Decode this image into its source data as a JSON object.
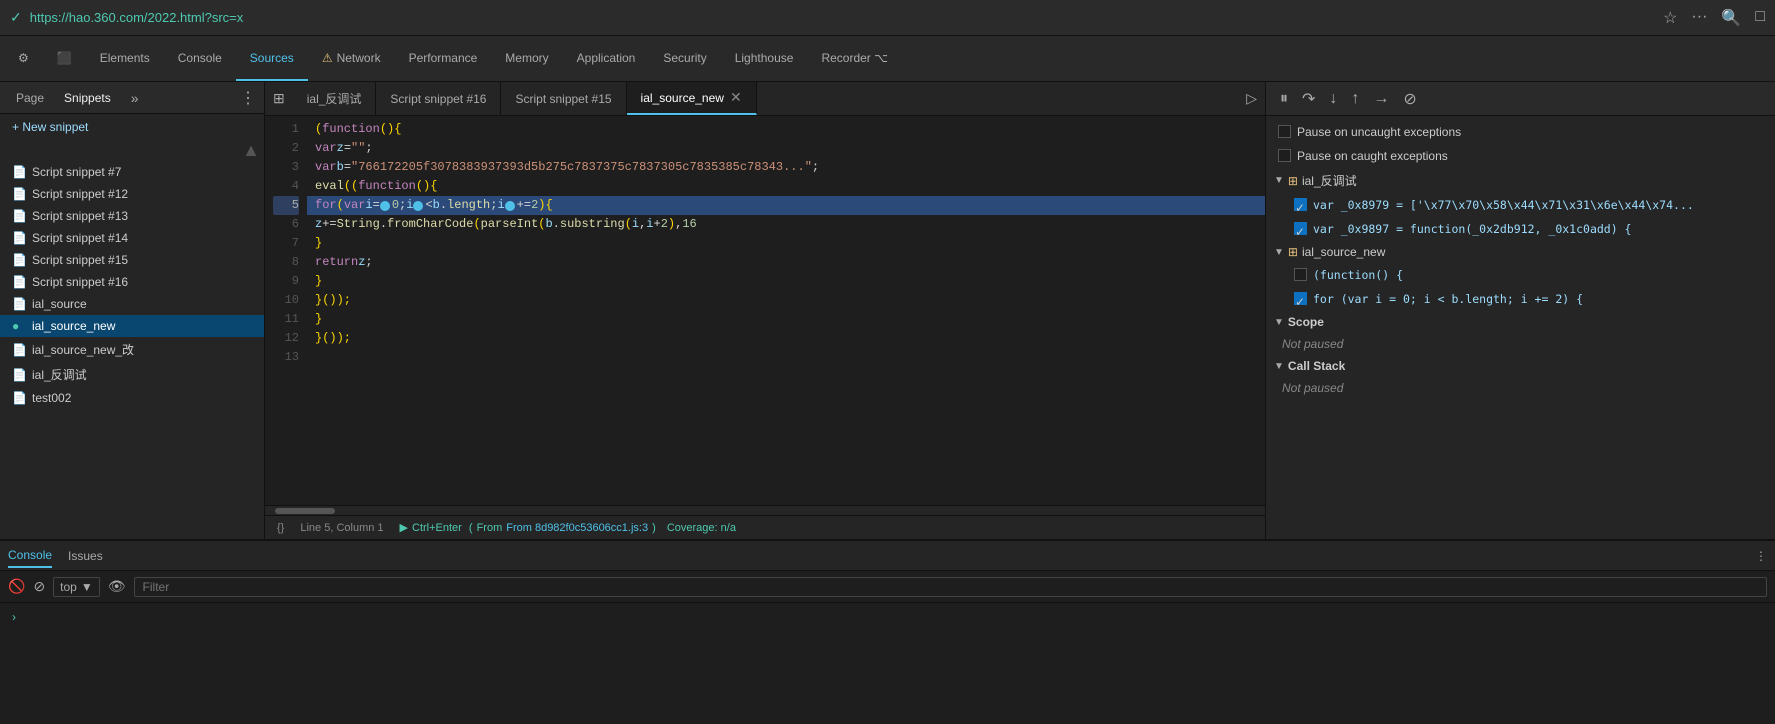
{
  "browser": {
    "url": "https://hao.360.com/2022.html?src=x",
    "favicon": "✓"
  },
  "devtools_tabs": [
    {
      "label": "⚙",
      "id": "toggle",
      "icon_only": true
    },
    {
      "label": "⬜",
      "id": "undock",
      "icon_only": true
    },
    {
      "label": "Elements",
      "id": "elements"
    },
    {
      "label": "Console",
      "id": "console"
    },
    {
      "label": "Sources",
      "id": "sources",
      "active": true
    },
    {
      "label": "Network",
      "id": "network",
      "warning": true
    },
    {
      "label": "Performance",
      "id": "performance"
    },
    {
      "label": "Memory",
      "id": "memory"
    },
    {
      "label": "Application",
      "id": "application"
    },
    {
      "label": "Security",
      "id": "security"
    },
    {
      "label": "Lighthouse",
      "id": "lighthouse"
    },
    {
      "label": "Recorder ⌥",
      "id": "recorder"
    }
  ],
  "sidebar": {
    "tabs": [
      {
        "label": "Page",
        "id": "page"
      },
      {
        "label": "Snippets",
        "id": "snippets",
        "active": true
      },
      {
        "label": "»",
        "id": "more"
      }
    ],
    "new_snippet_label": "+ New snippet",
    "items": [
      {
        "label": "Script snippet #7",
        "id": "snippet7",
        "type": "snippet"
      },
      {
        "label": "Script snippet #12",
        "id": "snippet12",
        "type": "snippet"
      },
      {
        "label": "Script snippet #13",
        "id": "snippet13",
        "type": "snippet"
      },
      {
        "label": "Script snippet #14",
        "id": "snippet14",
        "type": "snippet"
      },
      {
        "label": "Script snippet #15",
        "id": "snippet15",
        "type": "snippet"
      },
      {
        "label": "Script snippet #16",
        "id": "snippet16",
        "type": "snippet"
      },
      {
        "label": "ial_source",
        "id": "ial_source",
        "type": "snippet"
      },
      {
        "label": "ial_source_new",
        "id": "ial_source_new",
        "type": "snippet_green",
        "active": true
      },
      {
        "label": "ial_source_new_改",
        "id": "ial_source_new_kai",
        "type": "snippet"
      },
      {
        "label": "ial_反调试",
        "id": "ial_fan_tiaoshi",
        "type": "snippet"
      },
      {
        "label": "test002",
        "id": "test002",
        "type": "snippet"
      }
    ]
  },
  "editor_tabs": [
    {
      "label": "ial_反调试",
      "id": "tab_fan"
    },
    {
      "label": "Script snippet #16",
      "id": "tab_s16"
    },
    {
      "label": "Script snippet #15",
      "id": "tab_s15"
    },
    {
      "label": "ial_source_new",
      "id": "tab_ial_new",
      "active": true,
      "closeable": true
    }
  ],
  "code": {
    "lines": [
      {
        "num": 1,
        "text": "(function() {",
        "class": "plain"
      },
      {
        "num": 2,
        "text": "    var z = \"\";",
        "class": "plain"
      },
      {
        "num": 3,
        "text": "    var b = \"766172205f3078383937393d5b275c7837375c7837305c7835385c78343...\";",
        "class": "plain"
      },
      {
        "num": 4,
        "text": "    eval((function() {",
        "class": "plain"
      },
      {
        "num": 5,
        "text": "        for (var i = 0; i < b.length; i += 2) {",
        "class": "highlight"
      },
      {
        "num": 6,
        "text": "            z += String.fromCharCode(parseInt(b.substring(i, i + 2), 16)",
        "class": "plain"
      },
      {
        "num": 7,
        "text": "        }",
        "class": "plain"
      },
      {
        "num": 8,
        "text": "        return z;",
        "class": "plain"
      },
      {
        "num": 9,
        "text": "    }",
        "class": "plain"
      },
      {
        "num": 10,
        "text": "    }());",
        "class": "plain"
      },
      {
        "num": 11,
        "text": "}",
        "class": "plain"
      },
      {
        "num": 12,
        "text": "})();",
        "class": "plain"
      },
      {
        "num": 13,
        "text": "",
        "class": "plain"
      }
    ],
    "current_line": 5,
    "status_line": "Line 5, Column 1",
    "run_label": "Ctrl+Enter",
    "run_from": "From 8d982f0c53606cc1.js:3",
    "coverage": "Coverage: n/a"
  },
  "right_panel": {
    "pause_labels": [
      "Pause on uncaught exceptions",
      "Pause on caught exceptions"
    ],
    "watchpoints": {
      "title": "ial_反调试",
      "items": [
        {
          "label": "var _0x8979 = ['\\x77\\x70\\x58\\x44\\x71\\x31\\x6e\\x44\\x74...",
          "checked": true
        },
        {
          "label": "var _0x9897 = function(_0x2db912, _0x1c0add) {",
          "checked": true
        }
      ]
    },
    "breakpoints": {
      "title": "ial_source_new",
      "items": [
        {
          "label": "(function() {",
          "checked": false
        },
        {
          "label": "for (var i = 0; i < b.length; i += 2) {",
          "checked": true
        }
      ]
    },
    "scope_title": "Scope",
    "scope_text": "Not paused",
    "callstack_title": "Call Stack",
    "callstack_text": "Not paused"
  },
  "console": {
    "tabs": [
      {
        "label": "Console",
        "id": "console",
        "active": true
      },
      {
        "label": "Issues",
        "id": "issues"
      }
    ],
    "toolbar": {
      "ban_icon": "🚫",
      "context_label": "top",
      "eye_icon": "👁",
      "filter_placeholder": "Filter"
    },
    "prompt": ">"
  }
}
